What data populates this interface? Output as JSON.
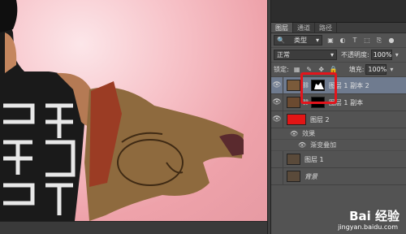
{
  "tabs": [
    "图层",
    "通道",
    "路径"
  ],
  "kind_filter": "类型",
  "blend_mode": "正常",
  "opacity_label": "不透明度:",
  "opacity_value": "100%",
  "lock_label": "锁定:",
  "fill_label": "填充:",
  "fill_value": "100%",
  "layers": [
    {
      "name": "图层 1 副本 2"
    },
    {
      "name": "图层 1 副本"
    },
    {
      "name": "图层 2"
    },
    {
      "name": "效果"
    },
    {
      "name": "渐变叠加"
    },
    {
      "name": "图层 1"
    },
    {
      "name": "背景"
    }
  ],
  "watermark": {
    "brand": "Bai 经验",
    "url": "jingyan.baidu.com"
  },
  "colors": {
    "highlight": "#e2151c",
    "selected_layer": "#6f7b8f",
    "canvas_bg": "#f4b8be"
  }
}
